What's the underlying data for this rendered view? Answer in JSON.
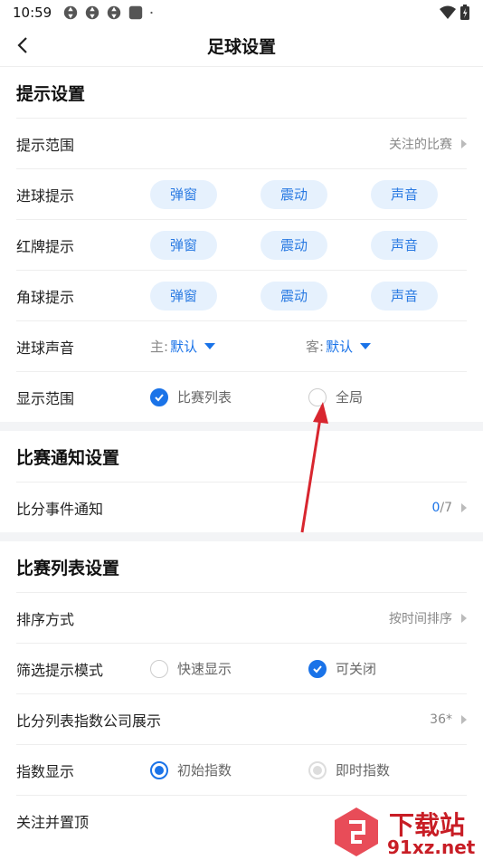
{
  "status_bar": {
    "time": "10:59"
  },
  "header": {
    "title": "足球设置"
  },
  "section1": {
    "title": "提示设置",
    "range": {
      "label": "提示范围",
      "value": "关注的比赛"
    },
    "goal": {
      "label": "进球提示",
      "chips": [
        "弹窗",
        "震动",
        "声音"
      ]
    },
    "red": {
      "label": "红牌提示",
      "chips": [
        "弹窗",
        "震动",
        "声音"
      ]
    },
    "corner": {
      "label": "角球提示",
      "chips": [
        "弹窗",
        "震动",
        "声音"
      ]
    },
    "sound": {
      "label": "进球声音",
      "home_key": "主:",
      "home_val": "默认",
      "away_key": "客:",
      "away_val": "默认"
    },
    "display": {
      "label": "显示范围",
      "opt1": "比赛列表",
      "opt2": "全局",
      "selected": "比赛列表"
    }
  },
  "section2": {
    "title": "比赛通知设置",
    "score_event": {
      "label": "比分事件通知",
      "count": "0",
      "total": "/7"
    }
  },
  "section3": {
    "title": "比赛列表设置",
    "sort": {
      "label": "排序方式",
      "value": "按时间排序"
    },
    "filter": {
      "label": "筛选提示模式",
      "opt1": "快速显示",
      "opt2": "可关闭",
      "selected": "可关闭"
    },
    "index_company": {
      "label": "比分列表指数公司展示",
      "value": "36*"
    },
    "index_display": {
      "label": "指数显示",
      "opt1": "初始指数",
      "opt2": "即时指数",
      "selected": "初始指数"
    },
    "follow_top": {
      "label": "关注并置顶"
    }
  },
  "watermark": {
    "brand": "下载站",
    "url": "91xz.net"
  },
  "colors": {
    "accent": "#1a73e8",
    "chip_bg": "#e6f1fd",
    "annotation_arrow": "#d8262f"
  }
}
